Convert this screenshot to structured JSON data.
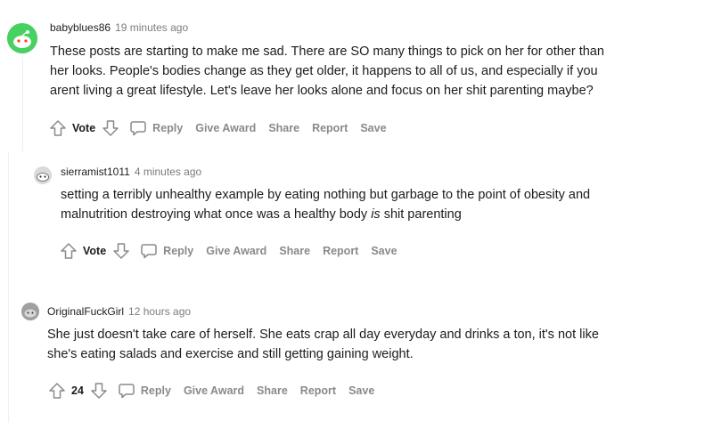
{
  "comments": [
    {
      "username": "babyblues86",
      "timestamp": "19 minutes ago",
      "lines": [
        "These posts are starting to make me sad. There are SO many things to pick on her for other than",
        "her looks. People's bodies change as they get older, it happens to all of us, and especially if you",
        "arent living a great lifestyle. Let's leave her looks alone and focus on her shit parenting maybe?"
      ],
      "vote_label": "Vote",
      "avatar_color": "#46d160"
    },
    {
      "username": "sierramist1011",
      "timestamp": "4 minutes ago",
      "lines": [
        "setting a terribly unhealthy example by eating nothing but garbage to the point of obesity and",
        "malnutrition destroying what once was a healthy body",
        "is",
        "shit parenting"
      ],
      "vote_label": "Vote",
      "avatar_color": "#dadada"
    },
    {
      "username": "OriginalFuckGirl",
      "timestamp": "12 hours ago",
      "lines": [
        "She just doesn't take care of herself. She eats crap all day everyday and drinks a ton, it's not like",
        "she's eating salads and exercise and still getting gaining weight."
      ],
      "vote_label": "24",
      "avatar_color": "#a0a0a0"
    }
  ],
  "actions": {
    "reply": "Reply",
    "give_award": "Give Award",
    "share": "Share",
    "report": "Report",
    "save": "Save"
  },
  "icons": {
    "upvote": "upvote-arrow-icon",
    "downvote": "downvote-arrow-icon",
    "reply": "speech-bubble-icon"
  },
  "colors": {
    "action_text": "#878a8c",
    "thread_line": "#edeff1",
    "text": "#1c1c1c",
    "meta": "#7c7c7c"
  }
}
